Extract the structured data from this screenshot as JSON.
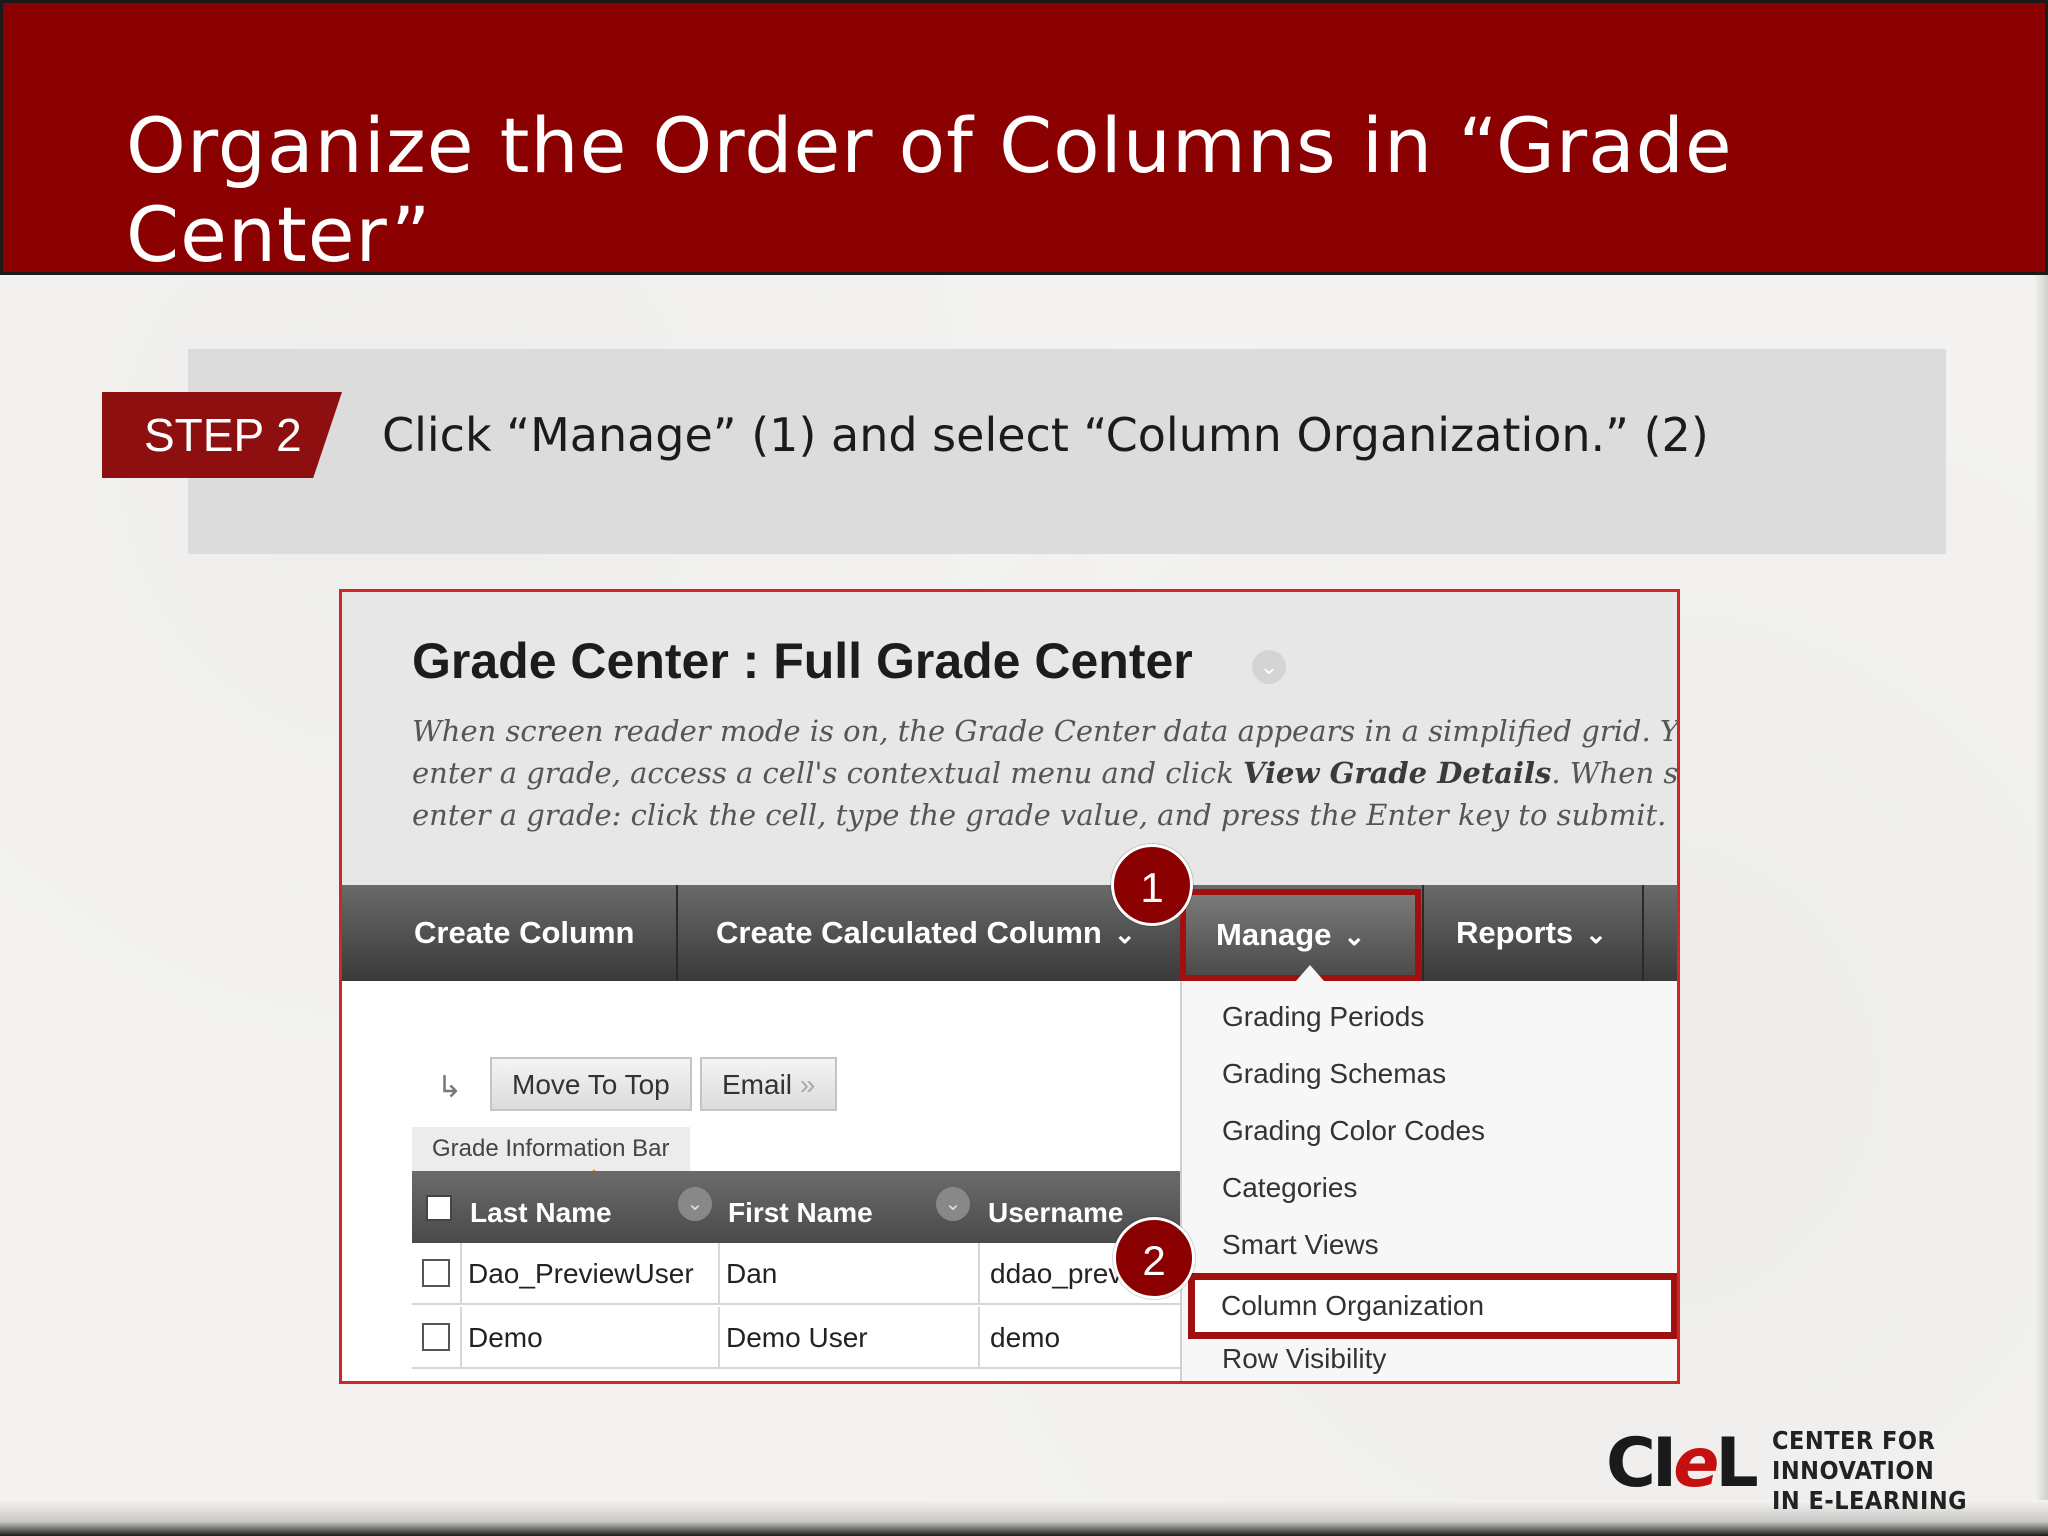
{
  "slide": {
    "title": "Organize the Order of Columns in “Grade Center”",
    "step_label": "STEP 2",
    "instruction": "Click “Manage” (1) and select “Column Organization.” (2)"
  },
  "screenshot": {
    "page_title": "Grade Center : Full Grade Center",
    "description_lines": [
      "When screen reader mode is on, the Grade Center data appears in a simplified grid. You cannot",
      "enter a grade, access a cell's contextual menu and click ",
      "View Grade Details",
      ". When screen rea",
      "enter a grade: click the cell, type the grade value, and press the Enter key to submit. Use the arr"
    ],
    "toolbar": {
      "create_column": "Create Column",
      "create_calculated_column": "Create Calculated Column",
      "manage": "Manage",
      "reports": "Reports"
    },
    "buttons": {
      "move_to_top": "Move To Top",
      "email": "Email"
    },
    "grade_info_bar": "Grade Information Bar",
    "columns": [
      "Last Name",
      "First Name",
      "Username"
    ],
    "rows": [
      {
        "last": "Dao_PreviewUser",
        "first": "Dan",
        "username": "ddao_prev"
      },
      {
        "last": "Demo",
        "first": "Demo User",
        "username": "demo"
      }
    ],
    "manage_menu": [
      "Grading Periods",
      "Grading Schemas",
      "Grading Color Codes",
      "Categories",
      "Smart Views",
      "Column Organization",
      "Row Visibility"
    ],
    "badges": [
      "1",
      "2"
    ]
  },
  "logo": {
    "mark_left": "CI",
    "mark_e": "e",
    "mark_right": "L",
    "line1": "CENTER FOR INNOVATION",
    "line2": "IN E-LEARNING"
  },
  "colors": {
    "header_red": "#8b0000",
    "highlight_red": "#a01010",
    "instruction_gray": "#dcdcdc"
  }
}
